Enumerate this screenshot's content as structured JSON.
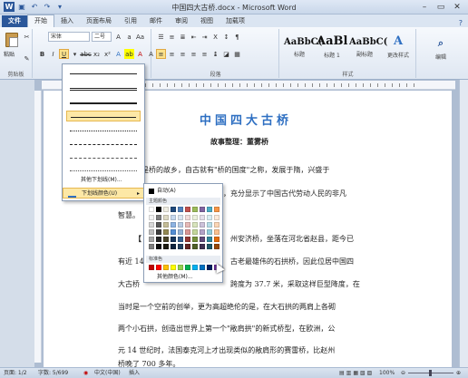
{
  "window": {
    "title": "中国四大古桥.docx - Microsoft Word"
  },
  "quick_access": [
    "save-icon",
    "undo-icon",
    "redo-icon",
    "customize-icon"
  ],
  "ribbon_tabs": [
    {
      "label": "文件"
    },
    {
      "label": "开始"
    },
    {
      "label": "插入"
    },
    {
      "label": "页面布局"
    },
    {
      "label": "引用"
    },
    {
      "label": "邮件"
    },
    {
      "label": "审阅"
    },
    {
      "label": "视图"
    },
    {
      "label": "加载项"
    }
  ],
  "ribbon": {
    "paste_label": "粘贴",
    "clipboard_label": "剪贴板",
    "font_name": "宋体",
    "font_size": "二号",
    "font_group_label": "字体",
    "paragraph_group_label": "段落",
    "styles_group_label": "样式",
    "styles": [
      {
        "sample": "AaBbC(",
        "name": "标题"
      },
      {
        "sample": "AaBl",
        "name": "标题 1"
      },
      {
        "sample": "AaBbC(",
        "name": "副标题"
      }
    ],
    "change_styles_label": "更改样式",
    "edit_label": "编辑"
  },
  "underline_menu": {
    "more_label": "其他下划线(M)...",
    "color_label": "下划线颜色(U)"
  },
  "color_menu": {
    "auto_label": "自动(A)",
    "theme_label": "主题颜色",
    "standard_label": "标准色",
    "more_label": "其他颜色(M)...",
    "theme_top": [
      "#ffffff",
      "#000000",
      "#eeece1",
      "#1f497d",
      "#4f81bd",
      "#c0504d",
      "#9bbb59",
      "#8064a2",
      "#4bacc6",
      "#f79646"
    ],
    "theme_columns": [
      [
        "#f2f2f2",
        "#d8d8d8",
        "#bfbfbf",
        "#a5a5a5",
        "#7f7f7f"
      ],
      [
        "#7f7f7f",
        "#595959",
        "#3f3f3f",
        "#262626",
        "#0c0c0c"
      ],
      [
        "#ddd9c3",
        "#c4bd97",
        "#938953",
        "#494429",
        "#1d1b10"
      ],
      [
        "#c6d9f0",
        "#8db3e2",
        "#548dd4",
        "#17365d",
        "#0f243e"
      ],
      [
        "#dbe5f1",
        "#b8cce4",
        "#95b3d7",
        "#366092",
        "#244061"
      ],
      [
        "#f2dcdb",
        "#e5b9b7",
        "#d99694",
        "#953734",
        "#632423"
      ],
      [
        "#ebf1dd",
        "#d7e3bc",
        "#c3d69b",
        "#76923c",
        "#4f6128"
      ],
      [
        "#e5e0ec",
        "#ccc1d9",
        "#b2a2c7",
        "#5f497a",
        "#3f3151"
      ],
      [
        "#dbeef3",
        "#b7dde8",
        "#92cddc",
        "#31859b",
        "#205867"
      ],
      [
        "#fdeada",
        "#fbd5b5",
        "#fac08f",
        "#e36c09",
        "#974806"
      ]
    ],
    "standard": [
      "#c00000",
      "#ff0000",
      "#ffc000",
      "#ffff00",
      "#92d050",
      "#00b050",
      "#00b0f0",
      "#0070c0",
      "#002060",
      "#7030a0"
    ]
  },
  "document": {
    "title": "中国四大古桥",
    "author_line": "故事整理：董雾桥",
    "lines": [
      "国是桥的故乡，自古就有\"桥的国度\"之称，发展于隋，兴盛于",
      "，充分显示了中国古代劳动人民的非凡",
      "智慧。",
      "【",
      "州安济桥，坐落在河北省赵县，距今已",
      "有近 14",
      "古老最雄伟的石拱桥，因此位居中国四",
      "大古桥",
      "跨度为 37.7 米，采取这样巨型降度，在",
      "当时是一个空前的创举，更为高超绝伦的是，在大石拱的两肩上各砌",
      "两个小石拱，创造出世界上第一个\"敞肩拱\"的新式桥型，在欧洲，公",
      "元 14 世纪时，法国泰克河上才出现类似的敞肩形的赛雷桥，比赵州",
      "桥晚了 700 多年。"
    ]
  },
  "status": {
    "page": "页面: 1/2",
    "words": "字数: 5/699",
    "language": "中文(中国)",
    "mode": "插入",
    "zoom": "100%"
  }
}
